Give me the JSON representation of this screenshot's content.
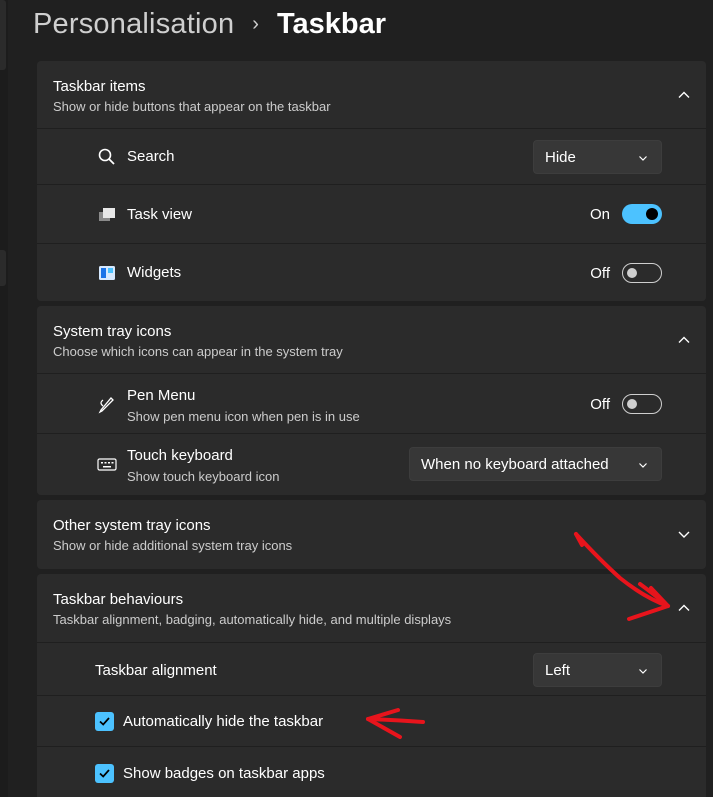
{
  "breadcrumb": {
    "parent": "Personalisation",
    "separator": "›",
    "current": "Taskbar"
  },
  "sections": {
    "taskbar_items": {
      "title": "Taskbar items",
      "subtitle": "Show or hide buttons that appear on the taskbar",
      "rows": {
        "search": {
          "label": "Search",
          "value": "Hide",
          "icon": "search-icon"
        },
        "task_view": {
          "label": "Task view",
          "state": "On",
          "icon": "task-view-icon"
        },
        "widgets": {
          "label": "Widgets",
          "state": "Off",
          "icon": "widgets-icon"
        }
      }
    },
    "system_tray": {
      "title": "System tray icons",
      "subtitle": "Choose which icons can appear in the system tray",
      "rows": {
        "pen_menu": {
          "label": "Pen Menu",
          "sublabel": "Show pen menu icon when pen is in use",
          "state": "Off",
          "icon": "pen-icon"
        },
        "touch_keyboard": {
          "label": "Touch keyboard",
          "sublabel": "Show touch keyboard icon",
          "value": "When no keyboard attached",
          "icon": "keyboard-icon"
        }
      }
    },
    "other_tray": {
      "title": "Other system tray icons",
      "subtitle": "Show or hide additional system tray icons"
    },
    "behaviours": {
      "title": "Taskbar behaviours",
      "subtitle": "Taskbar alignment, badging, automatically hide, and multiple displays",
      "rows": {
        "alignment": {
          "label": "Taskbar alignment",
          "value": "Left"
        },
        "auto_hide": {
          "label": "Automatically hide the taskbar",
          "checked": true
        },
        "badges": {
          "label": "Show badges on taskbar apps",
          "checked": true
        }
      }
    }
  },
  "colors": {
    "accent": "#4cc2ff",
    "annotation": "#e8141c",
    "card": "#2b2b2b",
    "background": "#202020"
  }
}
